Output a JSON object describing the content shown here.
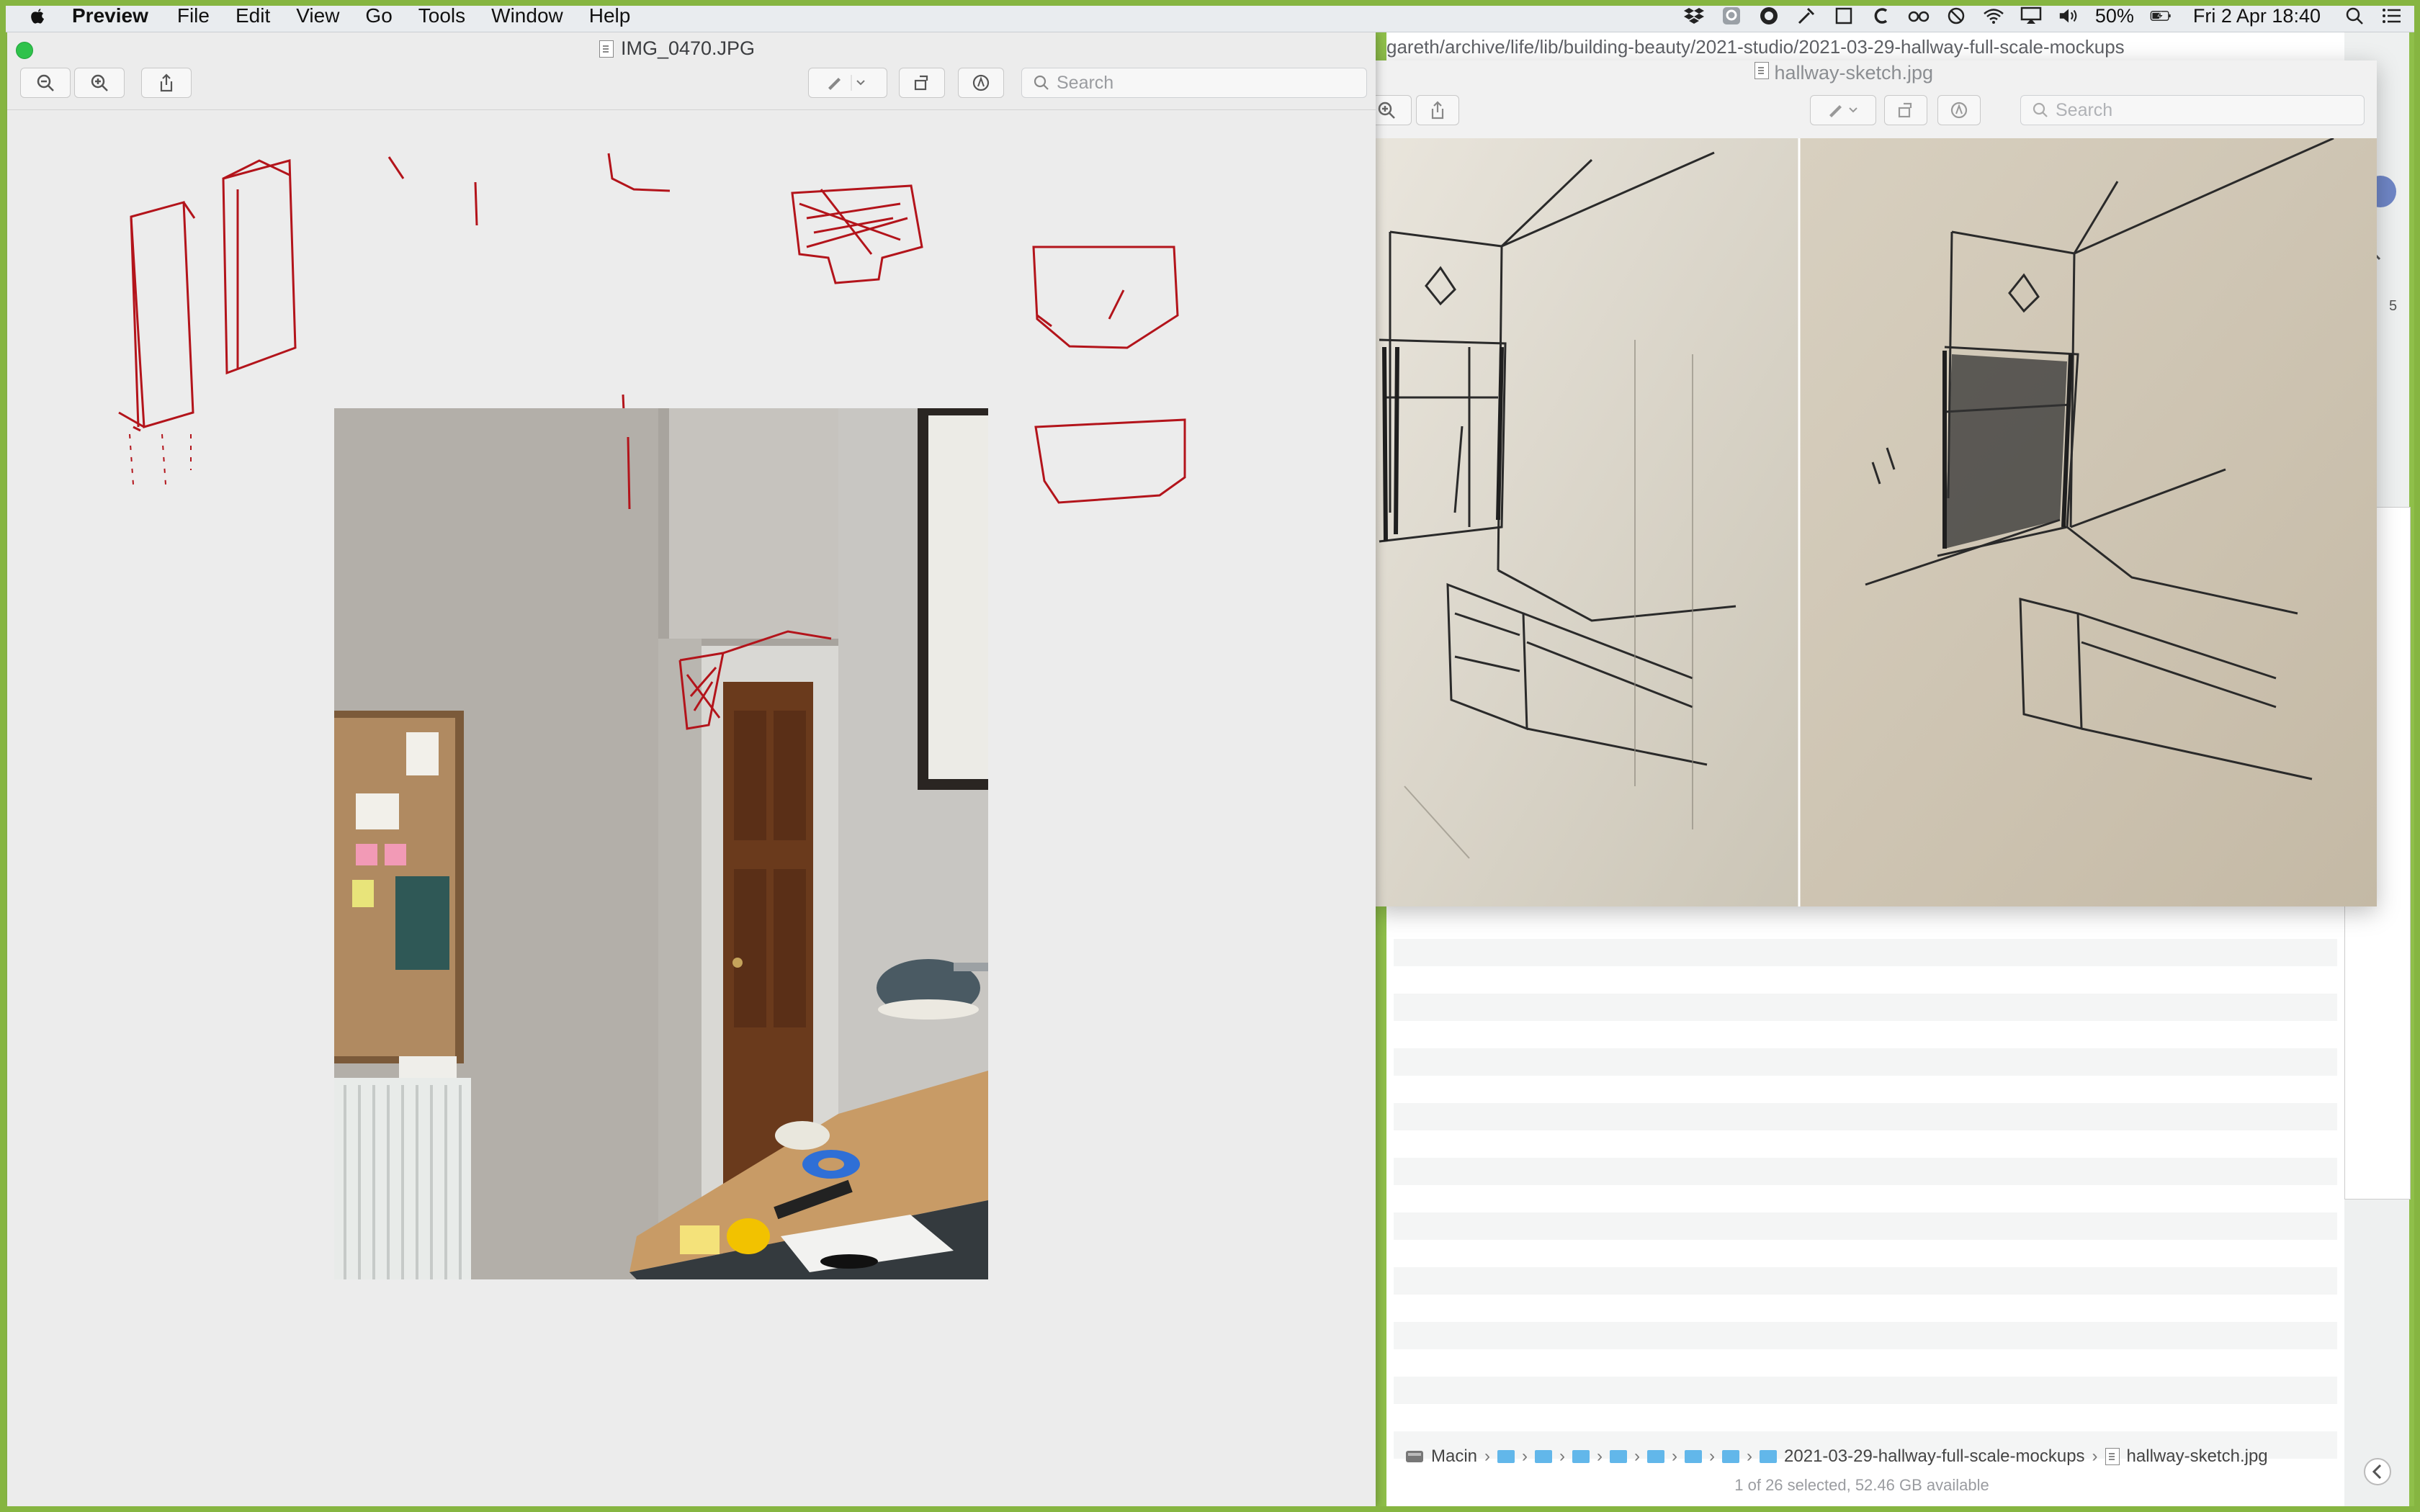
{
  "menubar": {
    "app_name": "Preview",
    "items": [
      "File",
      "Edit",
      "View",
      "Go",
      "Tools",
      "Window",
      "Help"
    ],
    "battery": "50%",
    "clock": "Fri 2 Apr  18:40"
  },
  "finder": {
    "path_text": "gareth/archive/life/lib/building-beauty/2021-studio/2021-03-29-hallway-full-scale-mockups",
    "pathbar": {
      "disk": "Macin",
      "folder": "2021-03-29-hallway-full-scale-mockups",
      "file": "hallway-sketch.jpg"
    },
    "status": "1 of 26 selected, 52.46 GB available",
    "side_label": "5"
  },
  "sketch_window": {
    "title": "hallway-sketch.jpg",
    "search_placeholder": "Search"
  },
  "main_window": {
    "title": "IMG_0470.JPG",
    "search_placeholder": "Search"
  },
  "colors": {
    "frame": "#86b541",
    "annotation": "#b3141b",
    "traffic_green": "#2fc24b"
  }
}
